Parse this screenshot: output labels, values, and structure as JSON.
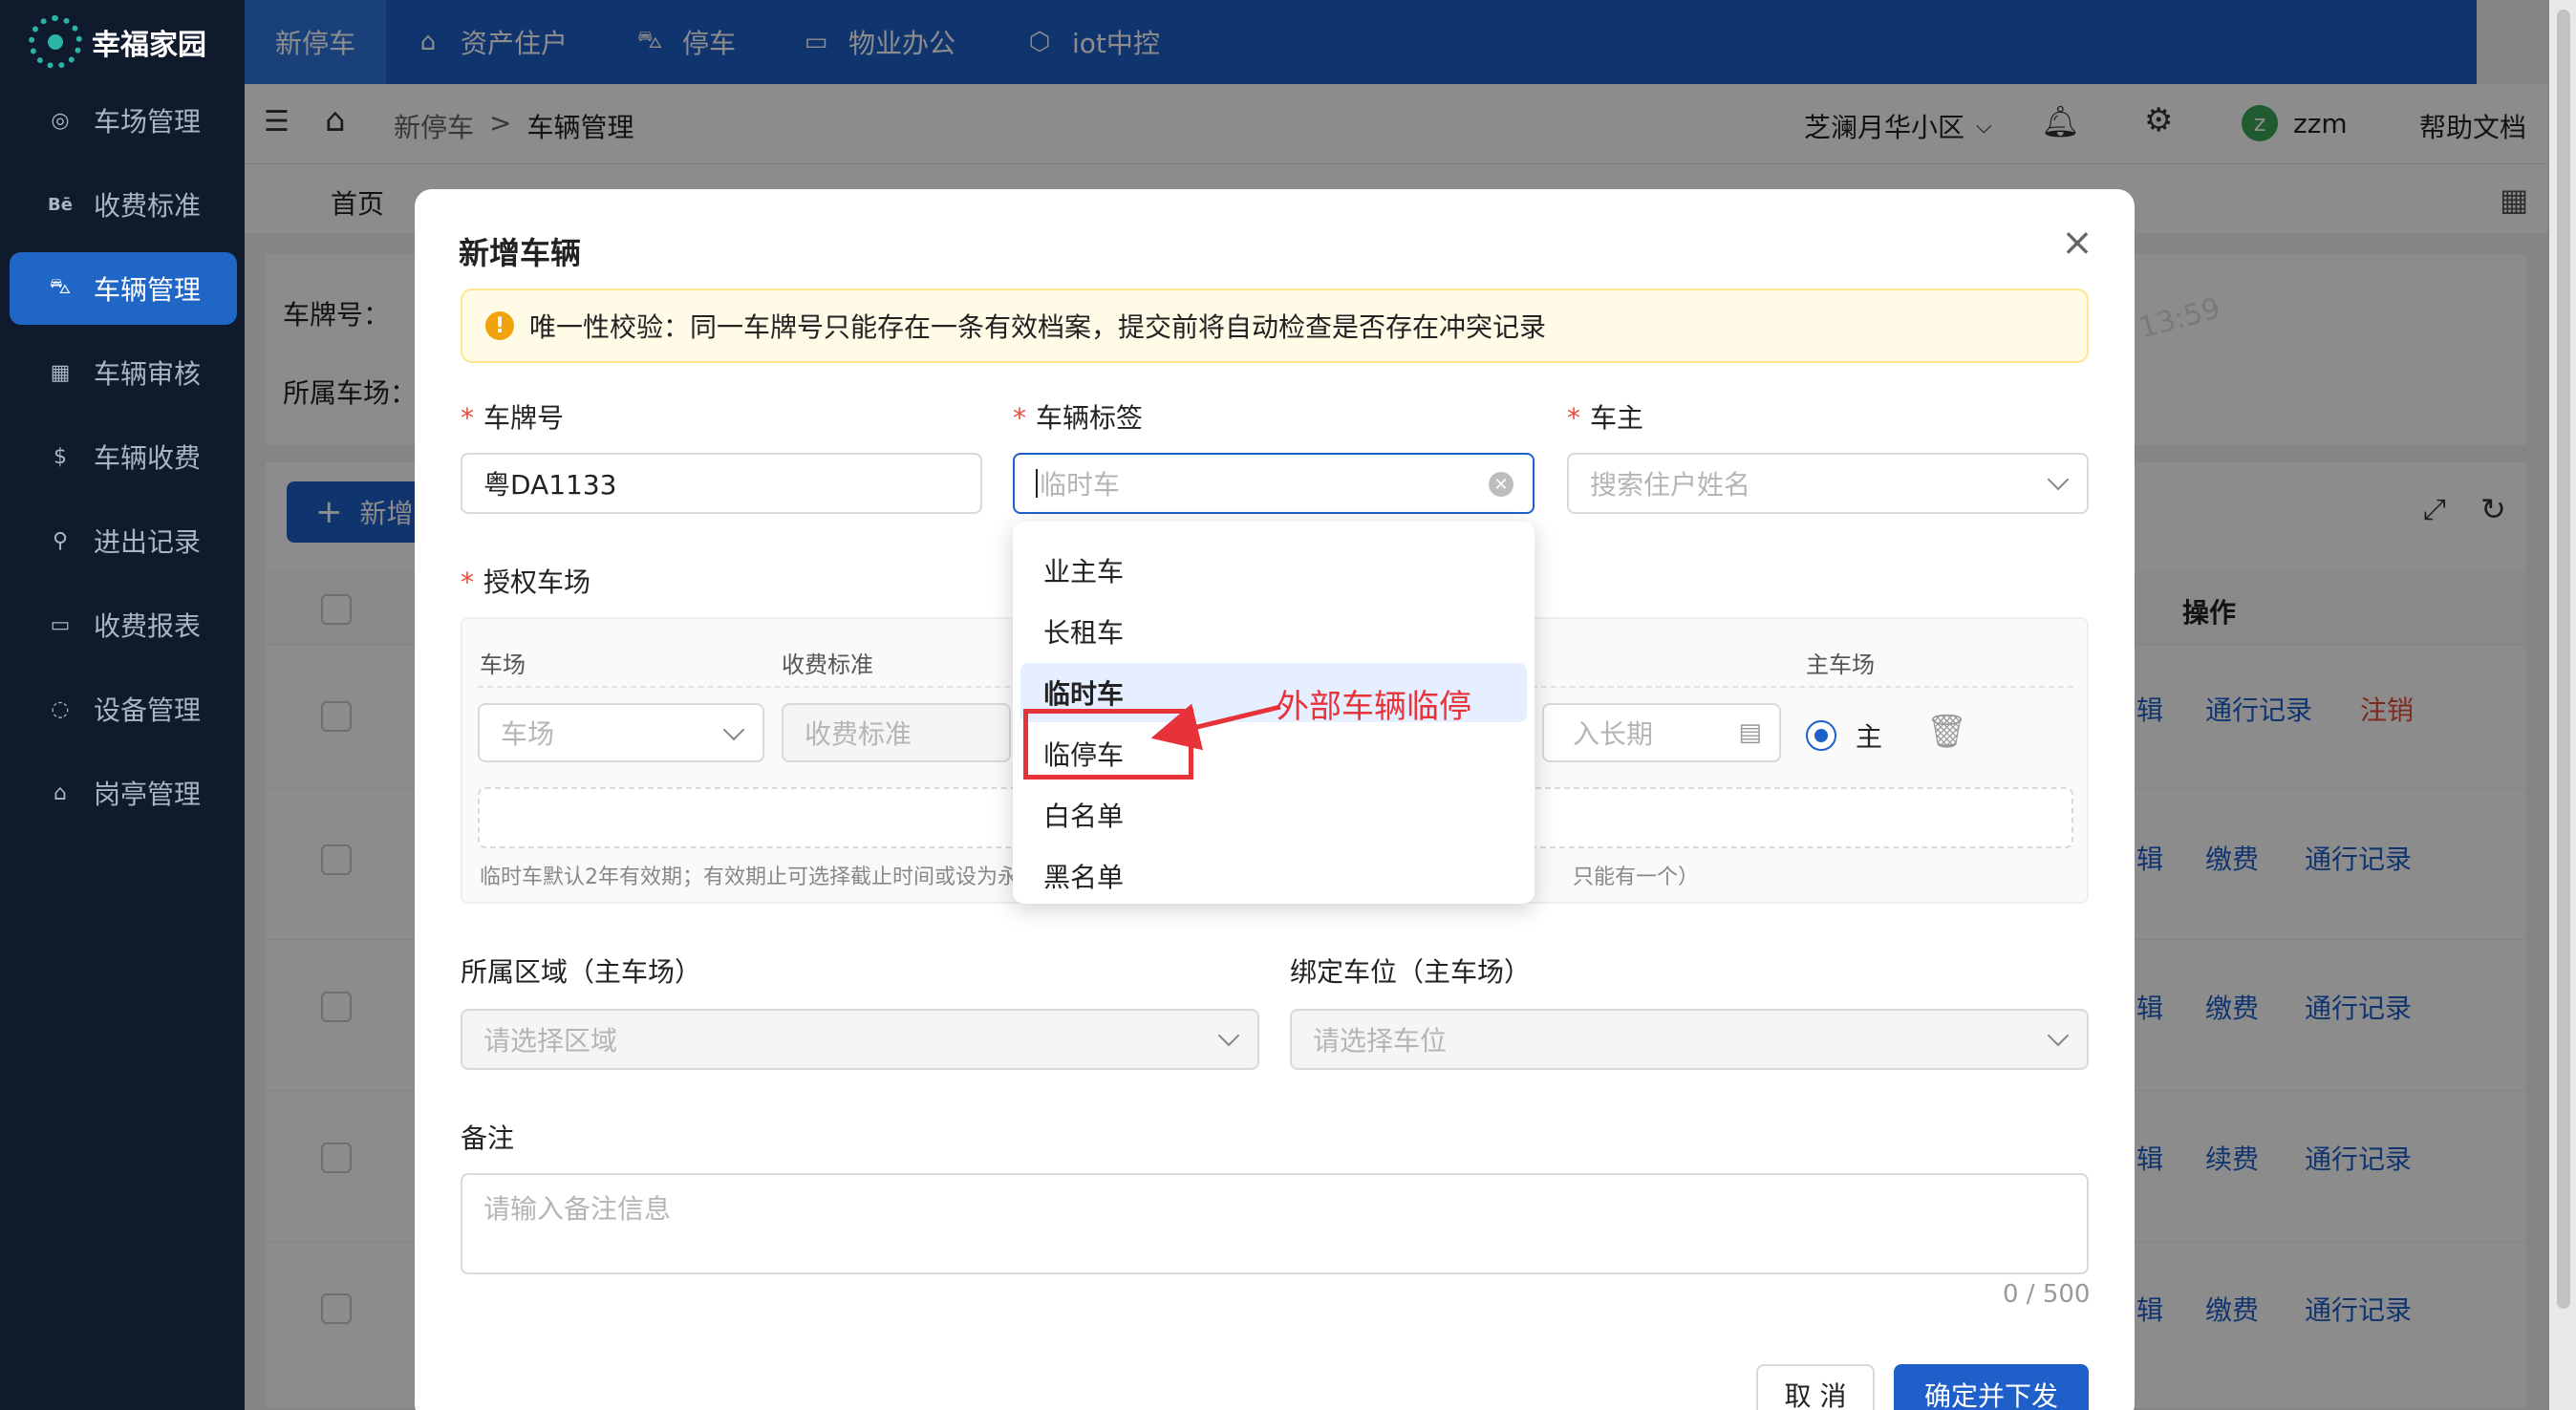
{
  "app": {
    "name": "幸福家园"
  },
  "sidebar": {
    "items": [
      {
        "label": "车场管理",
        "icon": "parking-icon"
      },
      {
        "label": "收费标准",
        "icon": "fee-standard-icon"
      },
      {
        "label": "车辆管理",
        "icon": "car-icon",
        "active": true
      },
      {
        "label": "车辆审核",
        "icon": "audit-icon"
      },
      {
        "label": "车辆收费",
        "icon": "dollar-icon"
      },
      {
        "label": "进出记录",
        "icon": "entry-record-icon"
      },
      {
        "label": "收费报表",
        "icon": "report-icon"
      },
      {
        "label": "设备管理",
        "icon": "device-icon"
      },
      {
        "label": "岗亭管理",
        "icon": "booth-icon"
      }
    ]
  },
  "topnav": {
    "items": [
      {
        "label": "新停车",
        "active": true
      },
      {
        "label": "资产住户",
        "icon": "home-icon"
      },
      {
        "label": "停车",
        "icon": "car-icon"
      },
      {
        "label": "物业办公",
        "icon": "monitor-icon"
      },
      {
        "label": "iot中控",
        "icon": "cube-icon"
      }
    ]
  },
  "header": {
    "breadcrumb": {
      "root": "新停车",
      "separator": ">",
      "current": "车辆管理"
    },
    "community": "芝澜月华小区",
    "user": {
      "initial": "z",
      "name": "zzm"
    },
    "help": "帮助文档"
  },
  "tabs": {
    "home": "首页"
  },
  "filter": {
    "plate_label": "车牌号：",
    "lot_label": "所属车场："
  },
  "background_table": {
    "add_button": "新增",
    "column_op": "操作",
    "watermark": "13:59",
    "rows": [
      {
        "actions": [
          "辑",
          "通行记录",
          "注销"
        ]
      },
      {
        "actions": [
          "辑",
          "缴费",
          "通行记录"
        ]
      },
      {
        "actions": [
          "辑",
          "缴费",
          "通行记录"
        ]
      },
      {
        "actions": [
          "辑",
          "续费",
          "通行记录"
        ]
      },
      {
        "actions": [
          "辑",
          "缴费",
          "通行记录"
        ]
      }
    ]
  },
  "modal": {
    "title": "新增车辆",
    "alert": "唯一性校验：同一车牌号只能存在一条有效档案，提交前将自动检查是否存在冲突记录",
    "plate": {
      "label": "车牌号",
      "value": "粤DA1133"
    },
    "tag": {
      "label": "车辆标签",
      "placeholder": "临时车"
    },
    "owner": {
      "label": "车主",
      "placeholder": "搜索住户姓名"
    },
    "lots": {
      "label": "授权车场",
      "col_lot": "车场",
      "col_fee": "收费标准",
      "col_main": "主车场",
      "lot_placeholder": "车场",
      "fee_placeholder": "收费标准",
      "date_placeholder": "长期",
      "date_prefix": "入",
      "main_radio": "主",
      "hint_left": "临时车默认2年有效期；有效期止可选择截止时间或设为永",
      "hint_right": "只能有一个）"
    },
    "area": {
      "label": "所属区域（主车场）",
      "placeholder": "请选择区域"
    },
    "space": {
      "label": "绑定车位（主车场）",
      "placeholder": "请选择车位"
    },
    "remark": {
      "label": "备注",
      "placeholder": "请输入备注信息",
      "counter": "0 / 500"
    },
    "buttons": {
      "cancel": "取 消",
      "confirm": "确定并下发"
    }
  },
  "dropdown": {
    "options": [
      "业主车",
      "长租车",
      "临时车",
      "临停车",
      "白名单",
      "黑名单"
    ],
    "selected": "临时车"
  },
  "annotation": {
    "text": "外部车辆临停",
    "color": "#e8323a"
  },
  "colors": {
    "primary": "#1e5fc9",
    "sidebar": "#0f1b2d",
    "danger": "#e84a3c",
    "alert_bg": "#fffbe6"
  }
}
